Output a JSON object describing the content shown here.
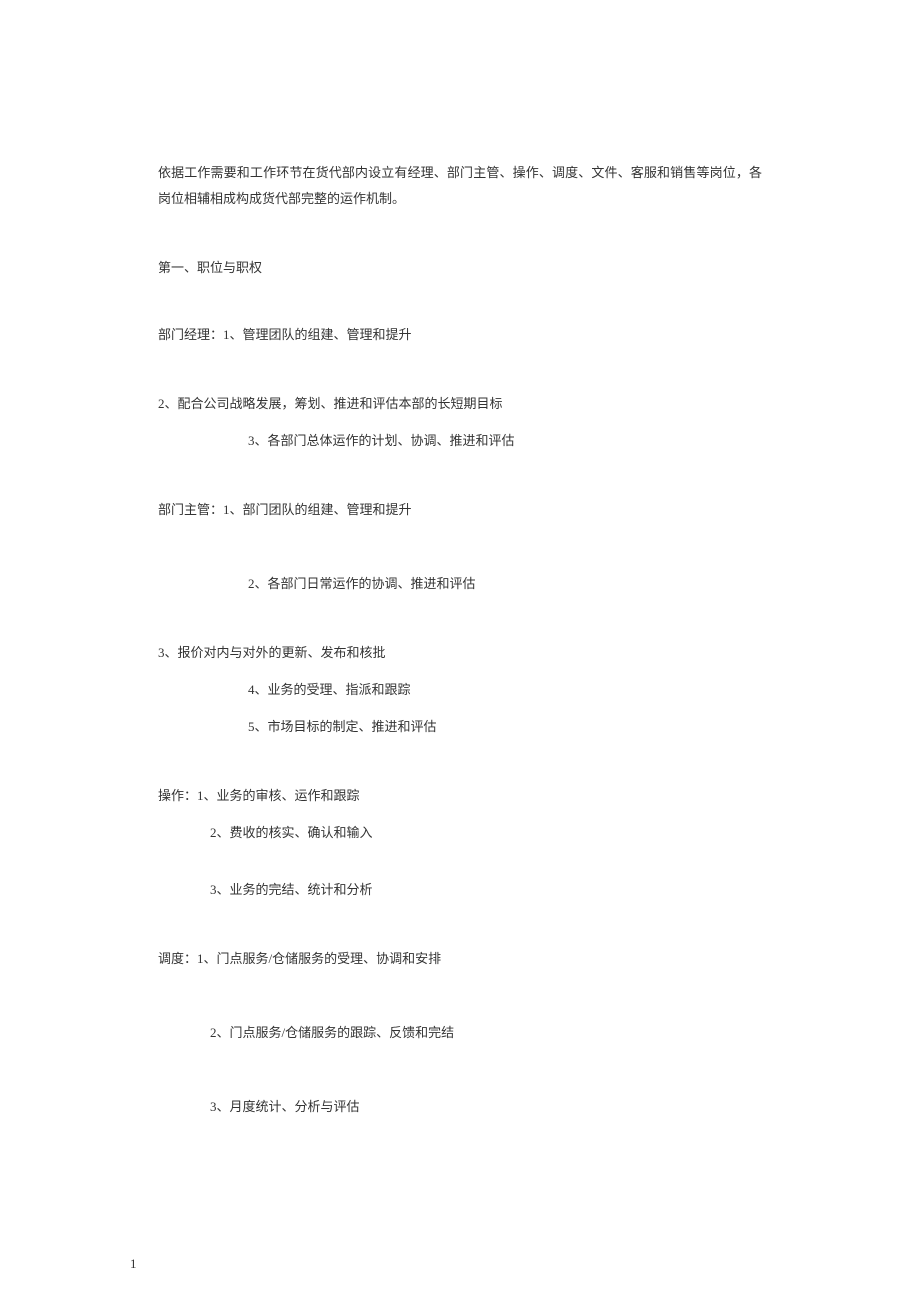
{
  "intro": "依据工作需要和工作环节在货代部内设立有经理、部门主管、操作、调度、文件、客服和销售等岗位，各岗位相辅相成构成货代部完整的运作机制。",
  "section_title": "第一、职位与职权",
  "roles": {
    "manager": {
      "title_line": "部门经理：1、管理团队的组建、管理和提升",
      "line2": "2、配合公司战略发展，筹划、推进和评估本部的长短期目标",
      "line3": "3、各部门总体运作的计划、协调、推进和评估"
    },
    "supervisor": {
      "title_line": "部门主管：1、部门团队的组建、管理和提升",
      "line2": "2、各部门日常运作的协调、推进和评估",
      "line3": "3、报价对内与对外的更新、发布和核批",
      "line4": "4、业务的受理、指派和跟踪",
      "line5": "5、市场目标的制定、推进和评估"
    },
    "operation": {
      "title_line": "操作：1、业务的审核、运作和跟踪",
      "line2": "2、费收的核实、确认和输入",
      "line3": "3、业务的完结、统计和分析"
    },
    "dispatch": {
      "title_line": "调度：1、门点服务/仓储服务的受理、协调和安排",
      "line2": "2、门点服务/仓储服务的跟踪、反馈和完结",
      "line3": "3、月度统计、分析与评估"
    }
  },
  "page_number": "1"
}
